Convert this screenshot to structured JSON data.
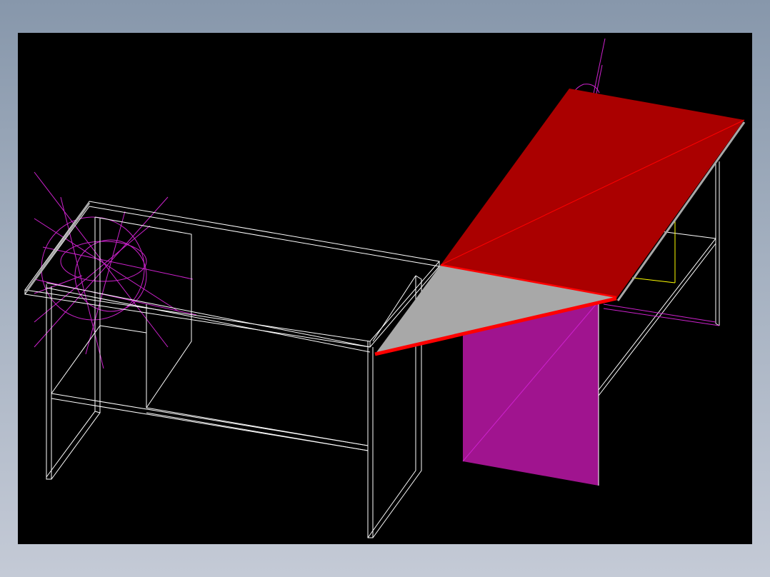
{
  "canvas": {
    "background_color": "#000000",
    "frame_color": "#8c9aae"
  },
  "model": {
    "colors": {
      "wireframe": "#ffffff",
      "top_surface": "#aa0000",
      "top_edge": "#ff0000",
      "corner_surface": "#a8a8a8",
      "panel_surface": "#a0148f",
      "construction_lines": "#cc22cc",
      "highlight_line": "#ffff00"
    }
  }
}
